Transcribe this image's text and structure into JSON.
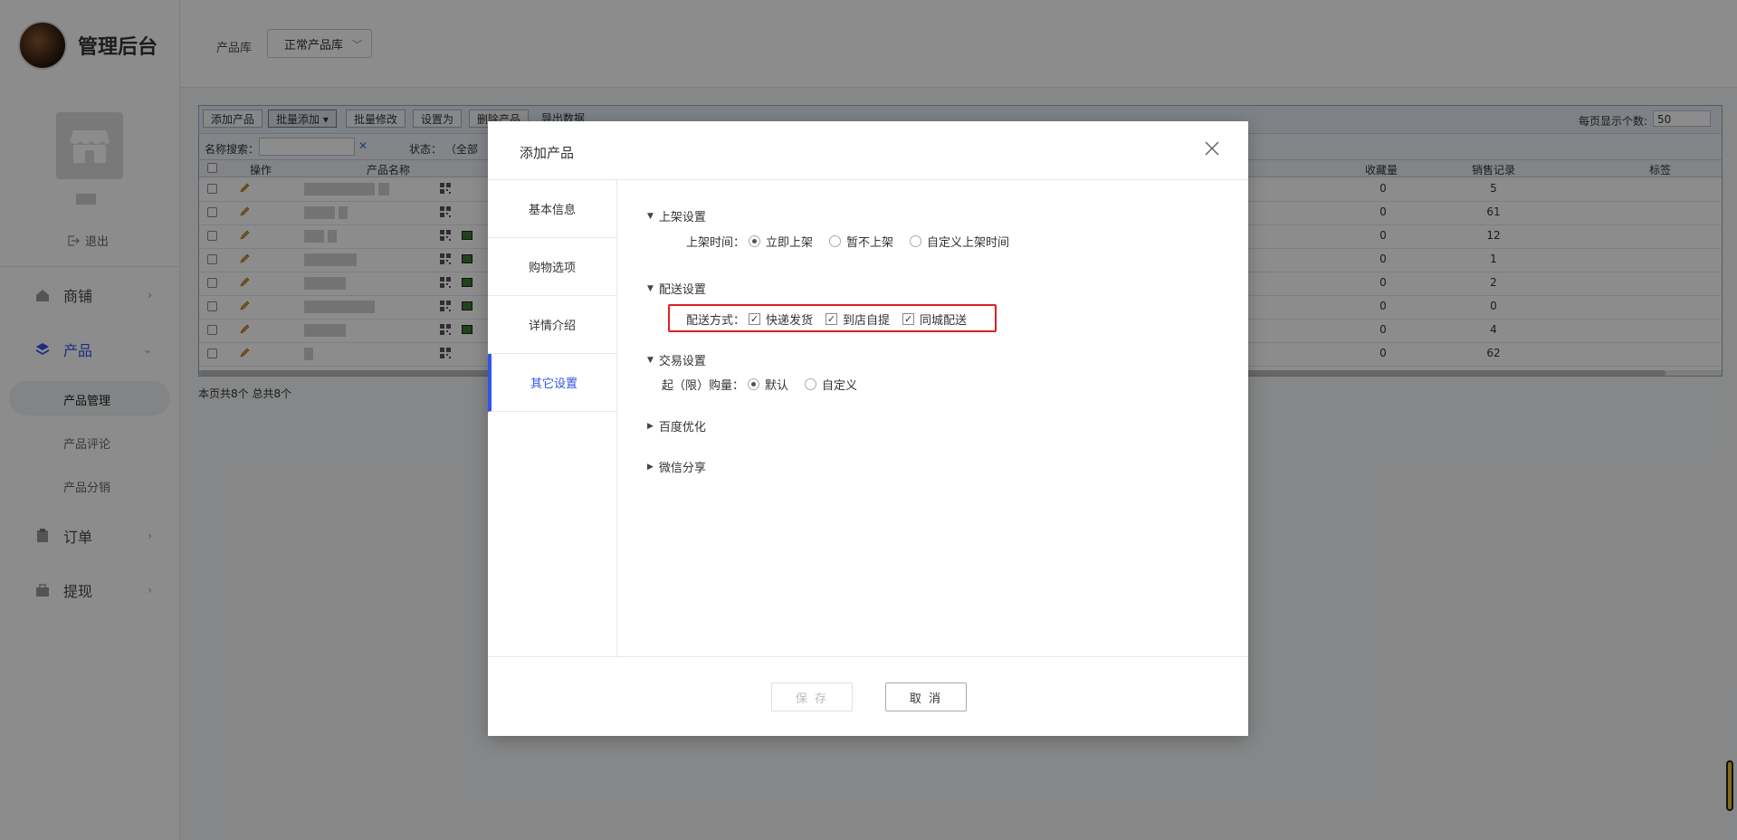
{
  "brand": {
    "title": "管理后台"
  },
  "sidebar": {
    "logout": "退出",
    "nav": [
      {
        "label": "商铺",
        "icon": "house-icon"
      },
      {
        "label": "产品",
        "icon": "layers-icon",
        "active": true
      },
      {
        "label": "订单",
        "icon": "clipboard-icon"
      },
      {
        "label": "提现",
        "icon": "bag-icon"
      }
    ],
    "sub": [
      {
        "label": "产品管理",
        "active": true
      },
      {
        "label": "产品评论"
      },
      {
        "label": "产品分销"
      }
    ]
  },
  "topbar": {
    "lib_label": "产品库",
    "lib_select": "正常产品库"
  },
  "grid": {
    "toolbar": [
      "添加产品",
      "批量添加 ▾",
      "批量修改",
      "设置为",
      "删除产品",
      "导出数据"
    ],
    "page_size_label": "每页显示个数:",
    "page_size": "50",
    "search_label": "名称搜索：",
    "status_label": "状态：",
    "status_value": "（全部",
    "headers": {
      "op": "操作",
      "name": "产品名称",
      "fav": "收藏量",
      "sales": "销售记录",
      "tag": "标签"
    },
    "rows": [
      {
        "fav": "0",
        "sales": "5"
      },
      {
        "fav": "0",
        "sales": "61"
      },
      {
        "fav": "0",
        "sales": "12"
      },
      {
        "fav": "0",
        "sales": "1"
      },
      {
        "fav": "0",
        "sales": "2"
      },
      {
        "fav": "0",
        "sales": "0"
      },
      {
        "fav": "0",
        "sales": "4"
      },
      {
        "fav": "0",
        "sales": "62"
      }
    ],
    "summary": "本页共8个 总共8个"
  },
  "modal": {
    "title": "添加产品",
    "tabs": [
      "基本信息",
      "购物选项",
      "详情介绍",
      "其它设置"
    ],
    "active_tab": 3,
    "sections": {
      "listing": {
        "title": "上架设置",
        "label": "上架时间：",
        "options": [
          "立即上架",
          "暂不上架",
          "自定义上架时间"
        ],
        "selected": 0
      },
      "delivery": {
        "title": "配送设置",
        "label": "配送方式：",
        "options": [
          "快递发货",
          "到店自提",
          "同城配送"
        ],
        "checked": [
          true,
          true,
          true
        ]
      },
      "trade": {
        "title": "交易设置",
        "label": "起（限）购量：",
        "options": [
          "默认",
          "自定义"
        ],
        "selected": 0
      },
      "seo": {
        "title": "百度优化"
      },
      "wechat": {
        "title": "微信分享"
      }
    },
    "save_label": "保 存",
    "cancel_label": "取 消"
  }
}
